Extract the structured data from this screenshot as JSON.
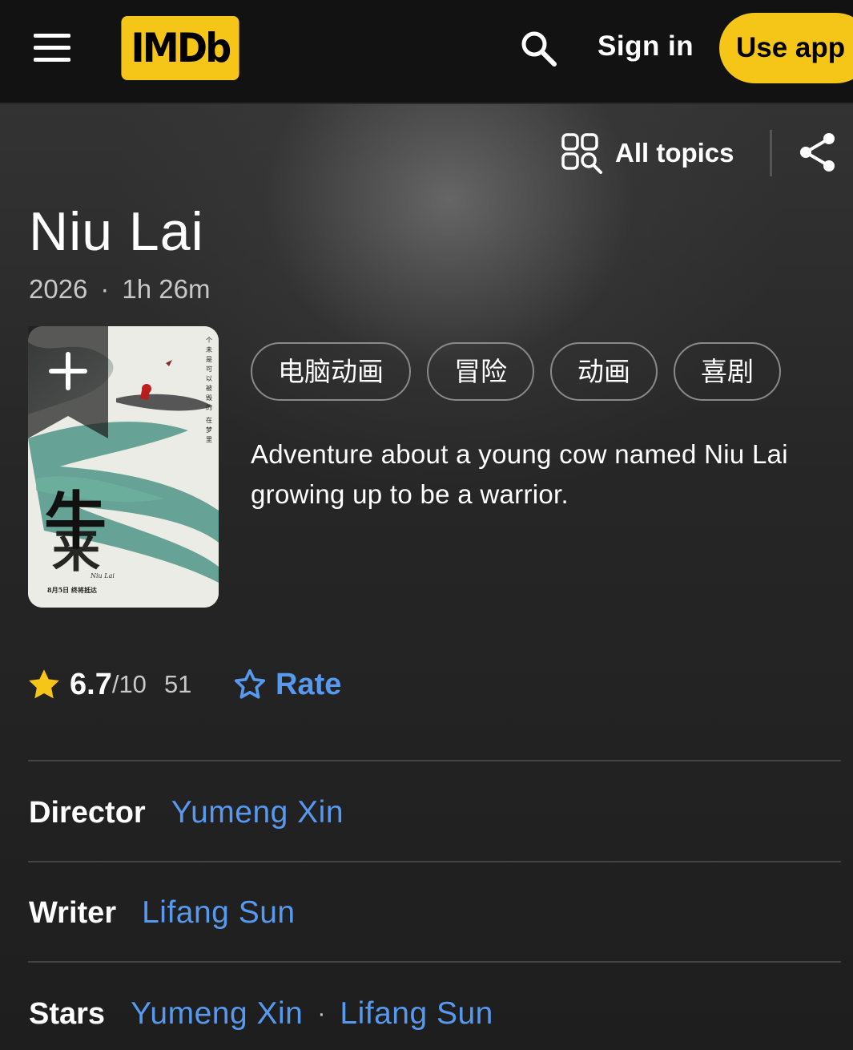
{
  "header": {
    "logo_text": "IMDb",
    "signin_label": "Sign in",
    "useapp_label": "Use app"
  },
  "toolbar": {
    "alltopics_label": "All topics"
  },
  "title": {
    "name": "Niu Lai",
    "year": "2026",
    "separator": "·",
    "runtime": "1h 26m"
  },
  "genres": [
    "电脑动画",
    "冒险",
    "动画",
    "喜剧"
  ],
  "plot": "Adventure about a young cow named Niu Lai growing up to be a warrior.",
  "rating": {
    "score": "6.7",
    "max": "/10",
    "count": "51",
    "rate_label": "Rate"
  },
  "credits": {
    "director_role": "Director",
    "director_name": "Yumeng Xin",
    "writer_role": "Writer",
    "writer_name": "Lifang Sun",
    "stars_role": "Stars",
    "stars": [
      "Yumeng Xin",
      "Lifang Sun"
    ],
    "stars_separator": "·"
  },
  "poster": {
    "text_title": "Niu Lai",
    "text_date": "8月5日  终将抵达",
    "text_vertical": "个 未 是 可 以 被 毁 的 · 在 梦 里 ·"
  },
  "colors": {
    "brand_yellow": "#f5c518",
    "link_blue": "#5799ef",
    "star_yellow": "#f5c518"
  },
  "icons": [
    "menu-icon",
    "search-icon",
    "all-topics-icon",
    "share-icon",
    "add-watchlist-icon",
    "star-filled-icon",
    "star-outline-icon"
  ]
}
